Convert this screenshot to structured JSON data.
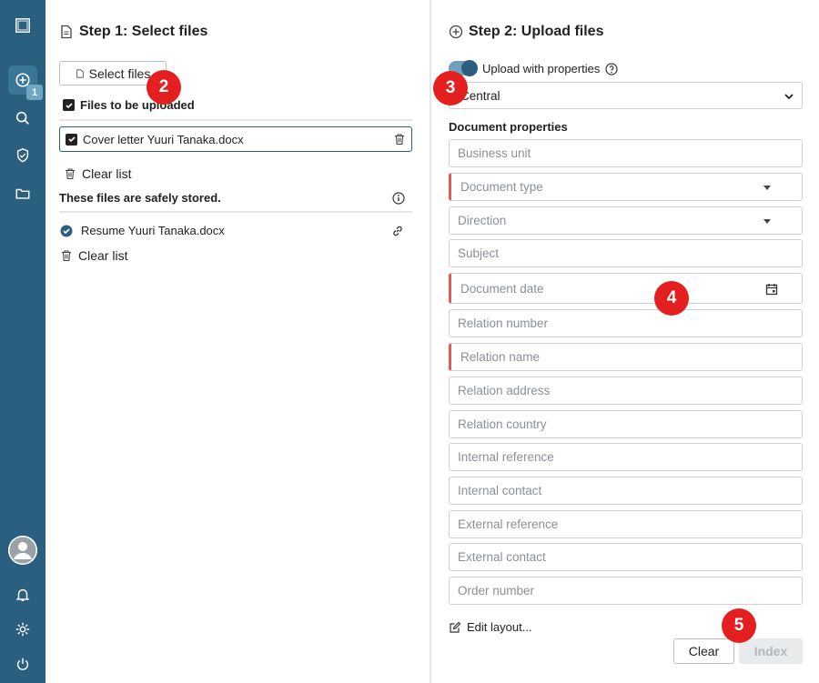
{
  "sidebar": {
    "badge_count": "1"
  },
  "left": {
    "step_title": "Step 1: Select files",
    "select_files_label": "Select files",
    "files_to_upload_label": "Files to be uploaded",
    "pending_file": "Cover letter Yuuri Tanaka.docx",
    "clear_list_1": "Clear list",
    "stored_heading": "These files are safely stored.",
    "stored_file": "Resume Yuuri Tanaka.docx",
    "clear_list_2": "Clear list"
  },
  "right": {
    "step_title": "Step 2: Upload files",
    "toggle_label": "Upload with properties",
    "location_value": "Central",
    "properties_heading": "Document properties",
    "fields": [
      {
        "label": "Business unit"
      },
      {
        "label": "Document type"
      },
      {
        "label": "Direction"
      },
      {
        "label": "Subject"
      },
      {
        "label": "Document date"
      },
      {
        "label": "Relation number"
      },
      {
        "label": "Relation name"
      },
      {
        "label": "Relation address"
      },
      {
        "label": "Relation country"
      },
      {
        "label": "Internal reference"
      },
      {
        "label": "Internal contact"
      },
      {
        "label": "External reference"
      },
      {
        "label": "External contact"
      },
      {
        "label": "Order number"
      }
    ],
    "edit_layout_label": "Edit layout...",
    "clear_button": "Clear",
    "index_button": "Index"
  },
  "markers": [
    "2",
    "3",
    "4",
    "5"
  ],
  "colors": {
    "sidebar": "#2b5f7f",
    "required": "#e25b5b",
    "marker": "#e41f1f"
  }
}
